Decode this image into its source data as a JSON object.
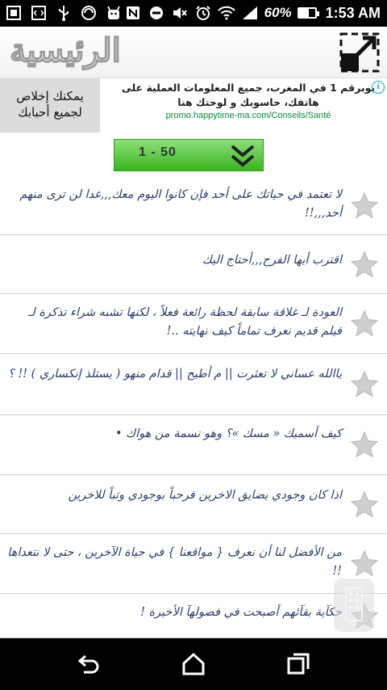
{
  "status_bar": {
    "icons_left": [
      "picture-icon",
      "code-icon",
      "usb-icon",
      "sync-icon",
      "android-icon"
    ],
    "icons_right": [
      "nfc-icon",
      "do-not-disturb-icon",
      "mute-icon",
      "alarm-icon",
      "wifi-icon",
      "signal-icon"
    ],
    "battery_percent": "60%",
    "battery_level": 0.6,
    "time": "1:53 AM"
  },
  "header": {
    "logo_text": "الرئيسية",
    "expand_icon": "expand-icon"
  },
  "ad": {
    "left_line1": "يمكنك إخلاص",
    "left_line2": "لجميع أحبابك",
    "title": "بوبرقم 1 في المغرب، جميع المعلومات العملية على هاتفك، حاسوبك و لوحتك هنا",
    "url": "promo.happytime-ma.com/Conseils/Santé",
    "info_label": "i"
  },
  "pager": {
    "label": "1 - 50",
    "icon": "double-chevron-down-icon"
  },
  "quotes": [
    {
      "text": "لا تعتمد في حياتك على أحد فإن كانوا اليوم معك,,,غدا لن ترى منهم أحد,,,!!"
    },
    {
      "text": "اقترب أيها الفرح,,,أحتاج اليك"
    },
    {
      "text": "العودة لـ غلاقة سابقة لحظة رائعة فعلاً ، لكنها تشبه شراء تذكرة لـ فيلم قديم نعرف تماماً كيف نهايته ..!"
    },
    {
      "text": "ياالله عساني لا تعثرت || م أطيح || قدام منهو ( يستلذ إنكساري ) !! ؟"
    },
    {
      "text": "كيف أسميك « مسك »؟ وهو نسمة من هواك •"
    },
    {
      "text": "اذا كان وجودي يضايق الاخرين فرحباً بوجودي وتباً للاخرين"
    },
    {
      "text": "من الأفضل لنا أن نعرف { مواقعنا } في حياة الآخرين ، حتى لا نتعداها !!"
    },
    {
      "text": "حكآية بقآئهم أصبحت في فصولهآ الأخيرة !"
    }
  ],
  "navbar": {
    "back": "back-icon",
    "home": "home-icon",
    "recents": "recents-icon"
  },
  "colors": {
    "pager_green": "#39b41e",
    "quote_text": "#2c3e6b",
    "ad_url": "#0b8a3a",
    "star_gray": "#cfcfcf"
  }
}
